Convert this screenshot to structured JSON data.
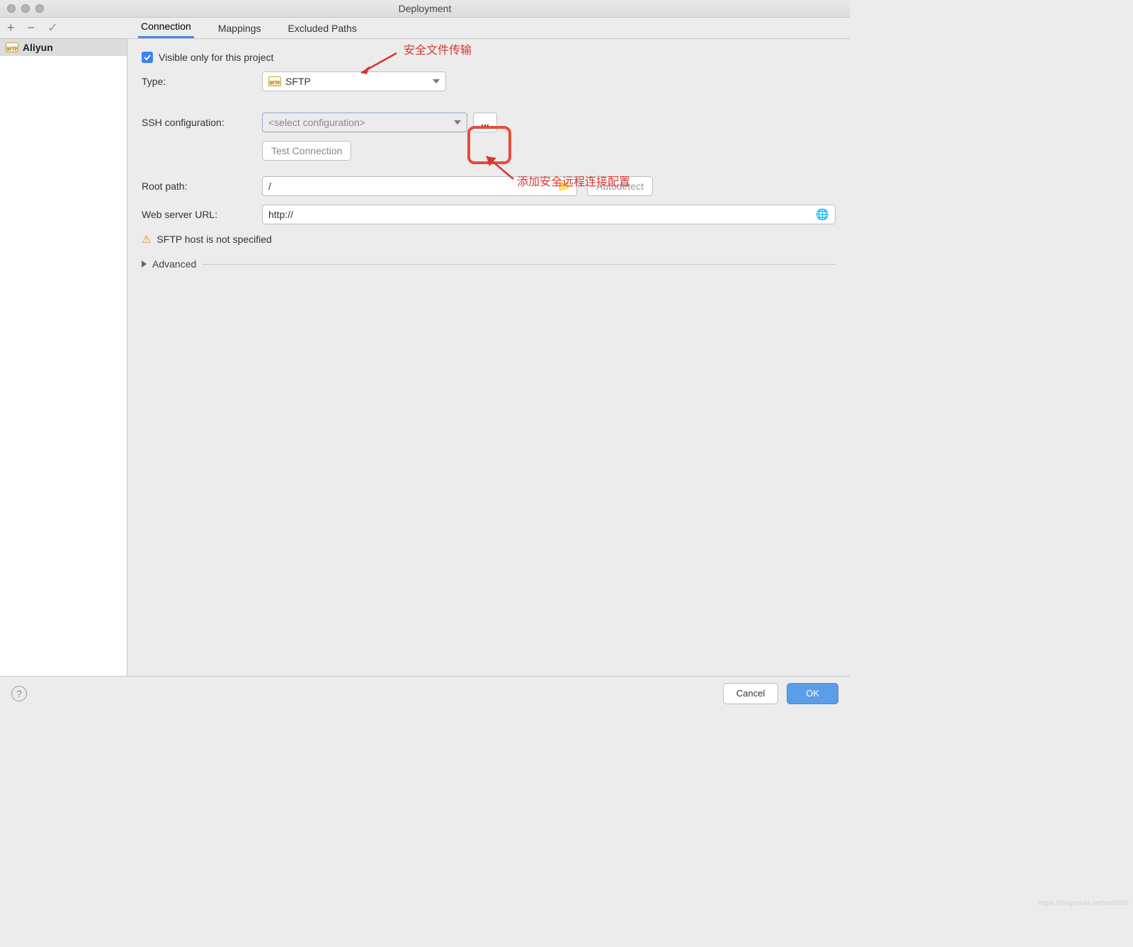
{
  "window": {
    "title": "Deployment"
  },
  "toolbar": {
    "add": "+",
    "remove": "−",
    "check": "✓"
  },
  "tabs": {
    "connection": "Connection",
    "mappings": "Mappings",
    "excluded": "Excluded Paths"
  },
  "sidebar": {
    "items": [
      {
        "name": "Aliyun"
      }
    ]
  },
  "form": {
    "visible_only_label": "Visible only for this project",
    "visible_only_checked": true,
    "type_label": "Type:",
    "type_value": "SFTP",
    "ssh_label": "SSH configuration:",
    "ssh_placeholder": "<select configuration>",
    "browse_label": "...",
    "test_connection": "Test Connection",
    "root_path_label": "Root path:",
    "root_path_value": "/",
    "autodetect": "Autodetect",
    "web_url_label": "Web server URL:",
    "web_url_value": "http://",
    "warning_text": "SFTP host is not specified",
    "advanced_label": "Advanced"
  },
  "annotations": {
    "secure_transfer": "安全文件传输",
    "add_ssh_config": "添加安全远程连接配置"
  },
  "footer": {
    "help": "?",
    "cancel": "Cancel",
    "ok": "OK"
  },
  "watermark": "https://blog.csdn.net/cat6368"
}
